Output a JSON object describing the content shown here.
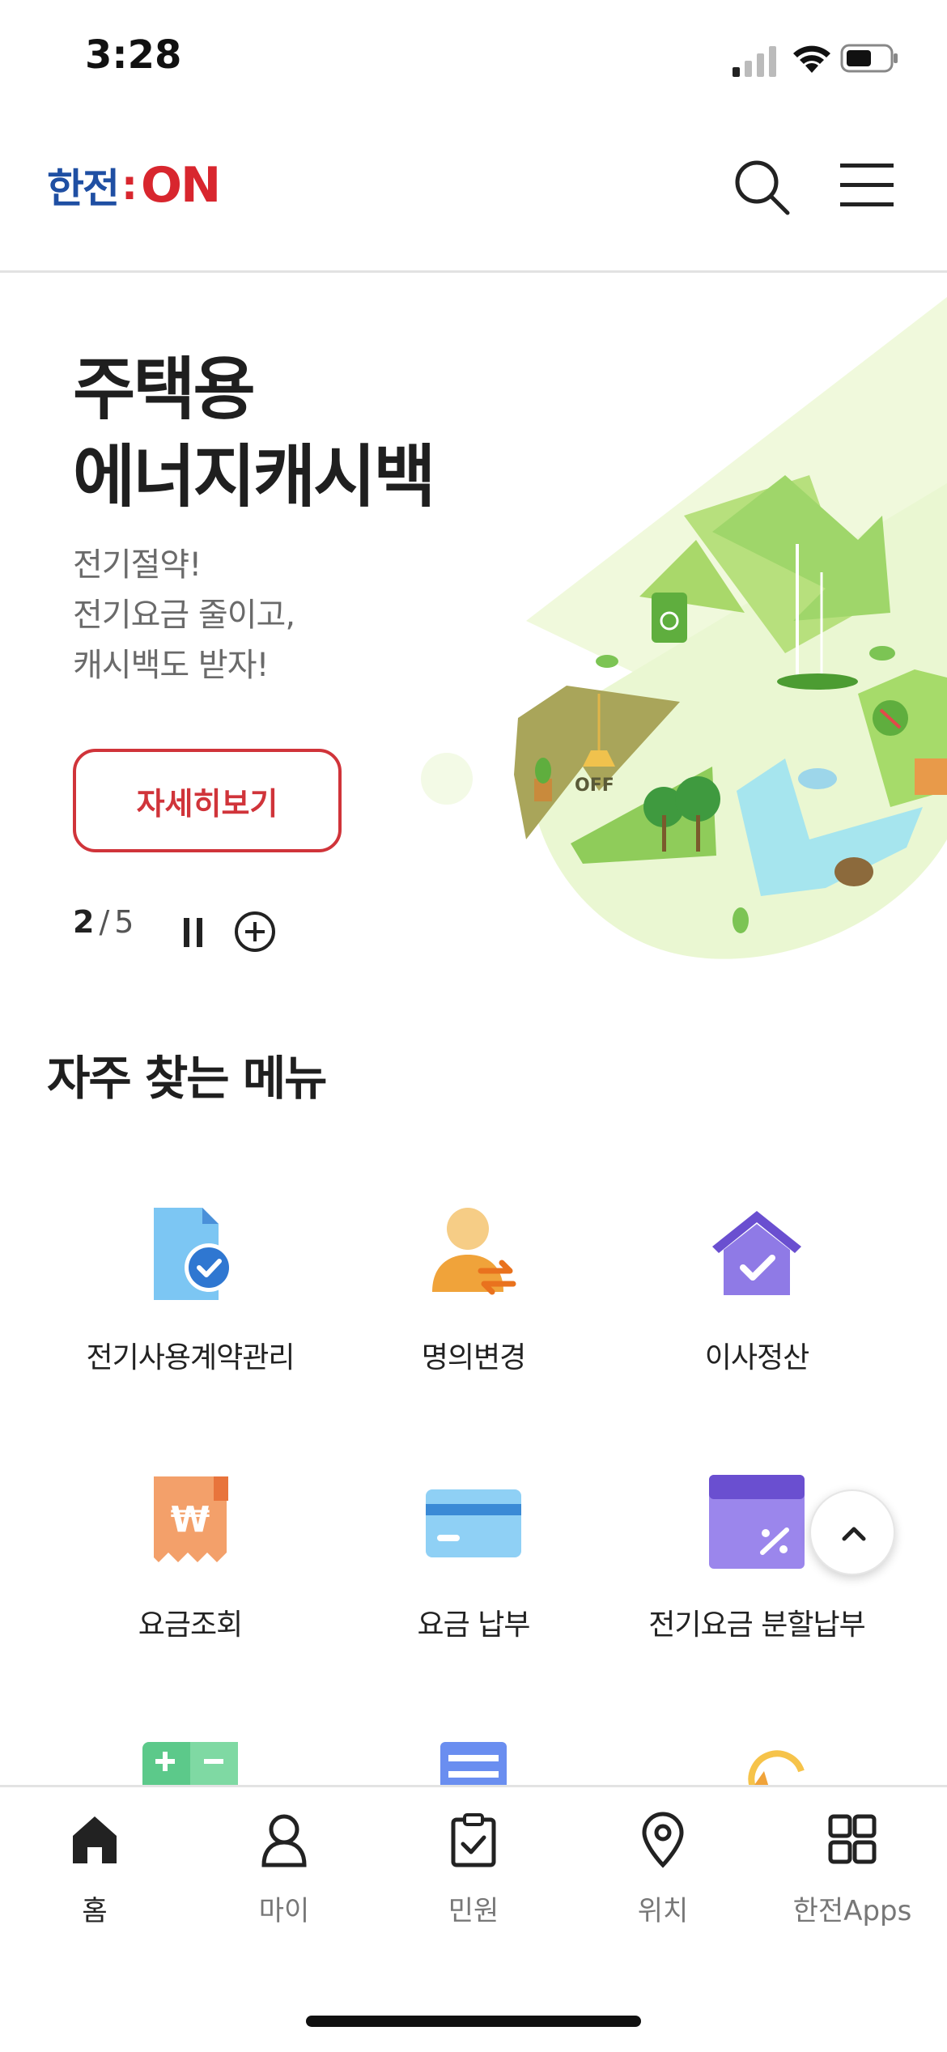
{
  "status_bar": {
    "time": "3:28"
  },
  "header": {
    "logo": {
      "korean": "한전",
      "colon": ":",
      "on": "ON"
    },
    "search_icon": "search-icon",
    "menu_icon": "hamburger-menu-icon"
  },
  "hero": {
    "title_line1": "주택용",
    "title_line2": "에너지캐시백",
    "subtitle_line1": "전기절약!",
    "subtitle_line2": "전기요금 줄이고,",
    "subtitle_line3": "캐시백도 받자!",
    "button_label": "자세히보기",
    "pager": {
      "current": "2",
      "separator": "/",
      "total": "5"
    },
    "art_text": "OFF",
    "colors": {
      "accent": "#d0343a",
      "leaf_light": "#eaf7d2",
      "leaf": "#a9d86a"
    }
  },
  "frequent_menu": {
    "title": "자주 찾는 메뉴",
    "items": [
      {
        "label": "전기사용계약관리",
        "icon": "contract-document-icon"
      },
      {
        "label": "명의변경",
        "icon": "name-change-person-icon"
      },
      {
        "label": "이사정산",
        "icon": "moving-house-icon"
      },
      {
        "label": "요금조회",
        "icon": "bill-receipt-icon"
      },
      {
        "label": "요금 납부",
        "icon": "credit-card-icon"
      },
      {
        "label": "전기요금 분할납부",
        "icon": "installment-calendar-icon"
      }
    ]
  },
  "scroll_top_icon": "chevron-up-icon",
  "bottom_nav": {
    "items": [
      {
        "label": "홈",
        "icon": "home-icon",
        "active": true
      },
      {
        "label": "마이",
        "icon": "person-icon",
        "active": false
      },
      {
        "label": "민원",
        "icon": "clipboard-check-icon",
        "active": false
      },
      {
        "label": "위치",
        "icon": "location-pin-icon",
        "active": false
      },
      {
        "label": "한전Apps",
        "icon": "grid-apps-icon",
        "active": false
      }
    ]
  }
}
